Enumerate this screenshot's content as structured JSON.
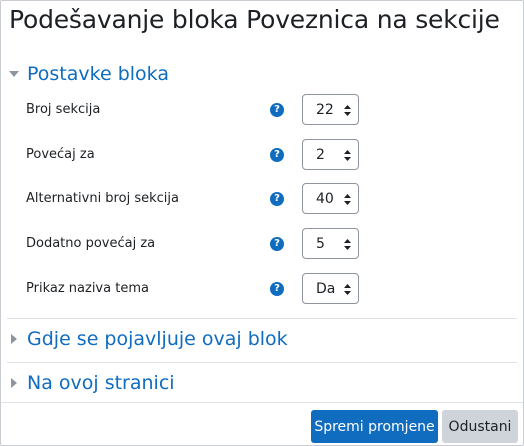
{
  "page": {
    "title": "Podešavanje bloka Poveznica na sekcije"
  },
  "sections": [
    {
      "title": "Postavke bloka",
      "expanded": true
    },
    {
      "title": "Gdje se pojavljuje ovaj blok",
      "expanded": false
    },
    {
      "title": "Na ovoj stranici",
      "expanded": false
    }
  ],
  "fields": [
    {
      "label": "Broj sekcija",
      "value": "22",
      "help_icon": "question-circle-icon"
    },
    {
      "label": "Povećaj za",
      "value": "2",
      "help_icon": "question-circle-icon"
    },
    {
      "label": "Alternativni broj sekcija",
      "value": "40",
      "help_icon": "question-circle-icon"
    },
    {
      "label": "Dodatno povećaj za",
      "value": "5",
      "help_icon": "question-circle-icon"
    },
    {
      "label": "Prikaz naziva tema",
      "value": "Da",
      "help_icon": "question-circle-icon"
    }
  ],
  "buttons": {
    "save": "Spremi promjene",
    "cancel": "Odustani"
  },
  "icons": {
    "help_glyph": "?"
  },
  "colors": {
    "link": "#0f6cbf",
    "primary": "#0f6cbf",
    "secondary": "#ced4da"
  }
}
